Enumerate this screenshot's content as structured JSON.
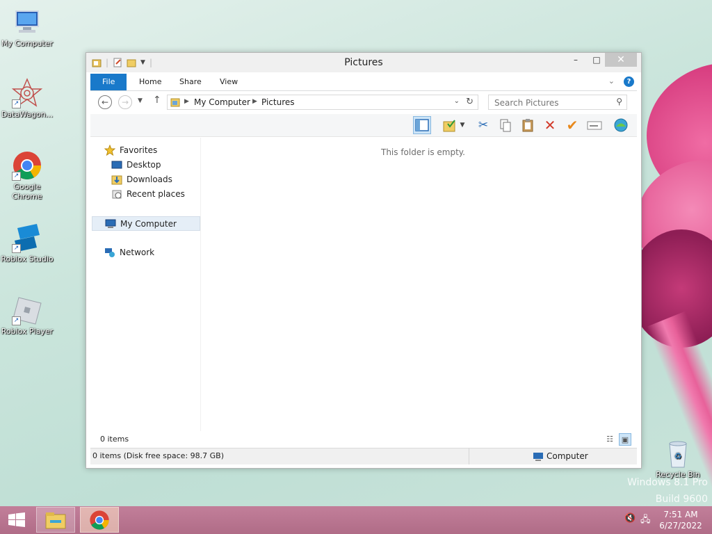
{
  "desktop": {
    "icons": [
      {
        "label": "My Computer"
      },
      {
        "label": "DataWagon..."
      },
      {
        "label": "Google Chrome"
      },
      {
        "label": "Roblox Studio"
      },
      {
        "label": "Roblox Player"
      },
      {
        "label": "Recycle Bin"
      }
    ],
    "watermark": {
      "line1": "Windows 8.1 Pro",
      "line2": "Build 9600"
    }
  },
  "window": {
    "title": "Pictures",
    "controls": {
      "minimize": "–",
      "maximize": "□",
      "close": "✕"
    },
    "ribbon": {
      "tabs": [
        "File",
        "Home",
        "Share",
        "View"
      ],
      "help": "?"
    },
    "address": {
      "crumbs": [
        "My Computer",
        "Pictures"
      ]
    },
    "search": {
      "placeholder": "Search Pictures"
    },
    "nav_pane": {
      "favorites": "Favorites",
      "favorites_items": [
        "Desktop",
        "Downloads",
        "Recent places"
      ],
      "my_computer": "My Computer",
      "network": "Network"
    },
    "content": {
      "empty_message": "This folder is empty."
    },
    "status": {
      "item_count": "0 items",
      "disk_info": "0 items (Disk free space: 98.7 GB)",
      "location": "Computer"
    }
  },
  "taskbar": {
    "clock_time": "7:51 AM",
    "clock_date": "6/27/2022"
  },
  "colors": {
    "accent": "#1979ca",
    "taskbar": "#b8758f",
    "selection": "#cce4f7"
  }
}
